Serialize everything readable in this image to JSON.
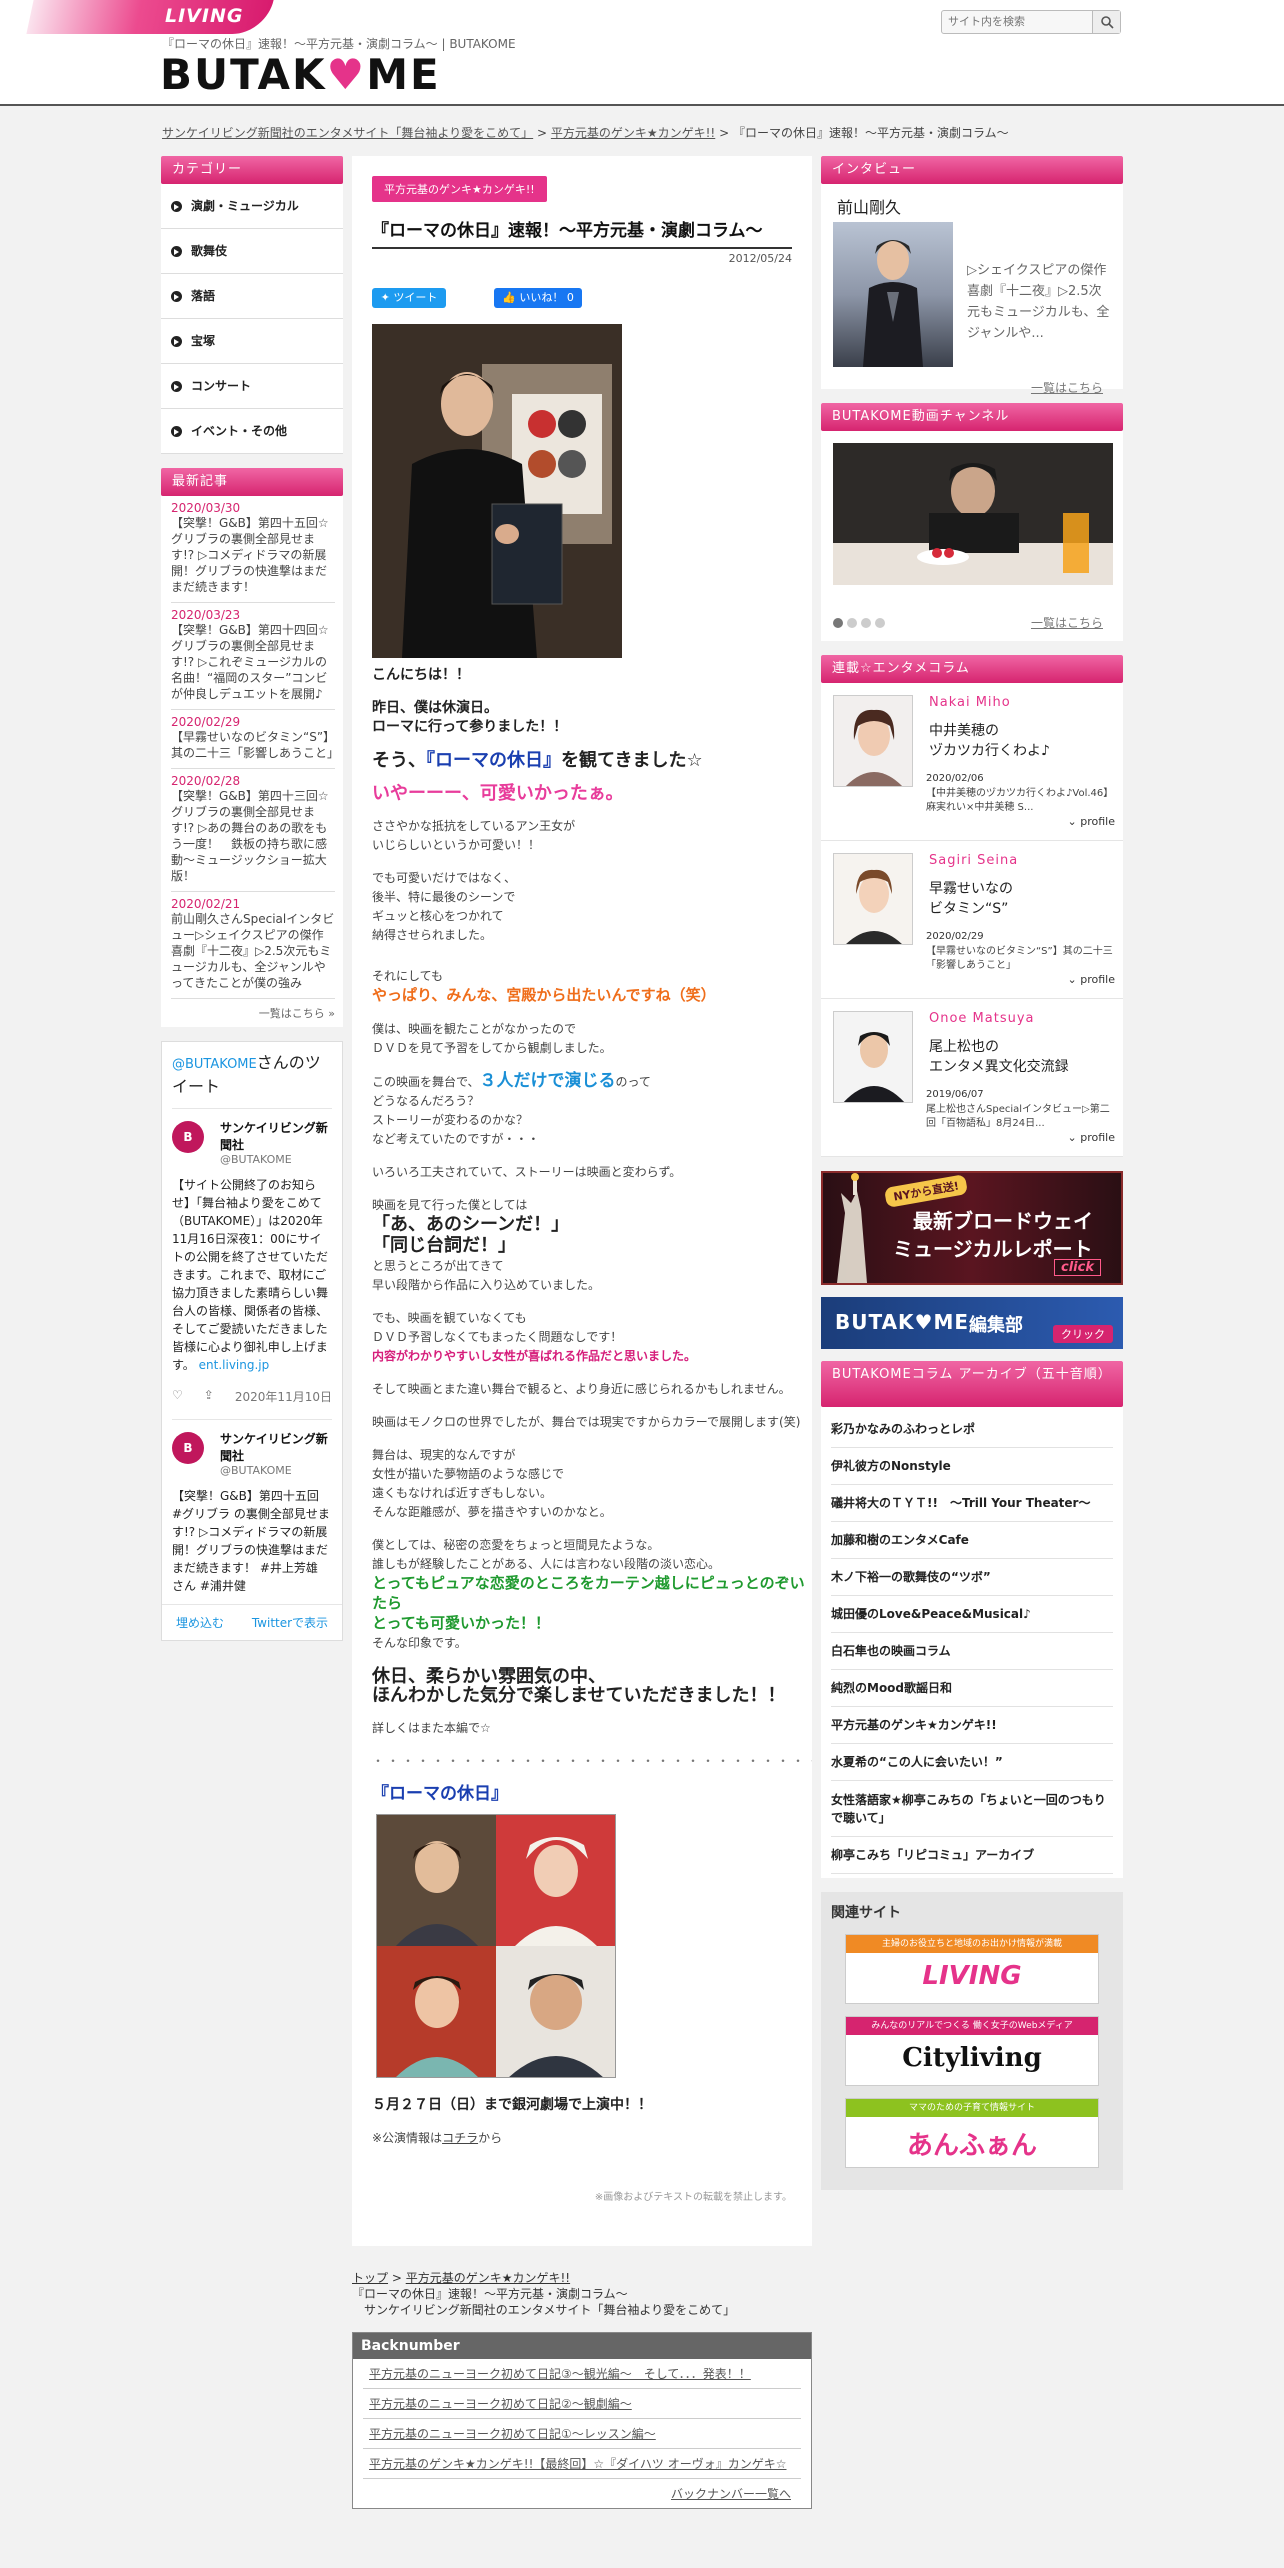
{
  "header": {
    "living_logo": "LIVING",
    "tagline": "『ローマの休日』速報！～平方元基・演劇コラム～ | BUTAKOME",
    "logo_left": "BUTAK",
    "logo_heart": "♥",
    "logo_right": "ME",
    "search_placeholder": "サイト内を検索"
  },
  "breadcrumb": {
    "home": "サンケイリビング新聞社のエンタメサイト「舞台袖より愛をこめて」",
    "sep1": " > ",
    "section": "平方元基のゲンキ★カンゲキ!!",
    "sep2": " > ",
    "current": "『ローマの休日』速報！～平方元基・演劇コラム～"
  },
  "categories": {
    "title": "カテゴリー",
    "items": [
      "演劇・ミュージカル",
      "歌舞伎",
      "落語",
      "宝塚",
      "コンサート",
      "イベント・その他"
    ]
  },
  "latest": {
    "title": "最新記事",
    "items": [
      {
        "date": "2020/03/30",
        "title": "【突撃！G&B】第四十五回☆グリブラの裏側全部見せます!? ▷コメディドラマの新展開！グリブラの快進撃はまだまだ続きます！"
      },
      {
        "date": "2020/03/23",
        "title": "【突撃！G&B】第四十四回☆グリブラの裏側全部見せます!? ▷これぞミュージカルの名曲！“福岡のスター”コンビが仲良しデュエットを展開♪"
      },
      {
        "date": "2020/02/29",
        "title": "【早霧せいなのビタミン“S”】其の二十三「影響しあうこと」"
      },
      {
        "date": "2020/02/28",
        "title": "【突撃！G&B】第四十三回☆グリブラの裏側全部見せます!? ▷あの舞台のあの歌をもう一度！　鉄板の持ち歌に感動～ミュージックショー拡大版！"
      },
      {
        "date": "2020/02/21",
        "title": "前山剛久さんSpecialインタビュー▷シェイクスピアの傑作喜劇『十二夜』▷2.5次元もミュージカルも、全ジャンルやってきたことが僕の強み"
      }
    ],
    "more": "一覧はこちら »"
  },
  "twitter": {
    "handle_link": "@BUTAKOME",
    "head_rest": "さんのツイート",
    "tweets": [
      {
        "avatar": "B",
        "name": "サンケイリビング新聞社",
        "handle": "@BUTAKOME",
        "text": "【サイト公開終了のお知らせ】「舞台袖より愛をこめて（BUTAKOME）」は2020年11月16日深夜1：00にサイトの公開を終了させていただきます。これまで、取材にご協力頂きました素晴らしい舞台人の皆様、関係者の皆様、そしてご愛読いただきました皆様に心より御礼申し上げます。",
        "link": "ent.living.jp",
        "date": "2020年11月10日"
      },
      {
        "avatar": "B",
        "name": "サンケイリビング新聞社",
        "handle": "@BUTAKOME",
        "text": "【突撃！G&B】第四十五回 #グリブラ の裏側全部見せます!? ▷コメディドラマの新展開！グリブラの快進撃はまだまだ続きます！ #井上芳雄 さん #浦井健",
        "link": "",
        "date": ""
      }
    ],
    "embed": "埋め込む",
    "view": "Twitterで表示"
  },
  "article": {
    "category_tag": "平方元基のゲンキ★カンゲキ!!",
    "title": "『ローマの休日』速報！～平方元基・演劇コラム～",
    "date": "2012/05/24",
    "tweet_btn": "ツイート",
    "like_btn": "いいね！ 0",
    "p1": "こんにちは！！",
    "p2a": "昨日、僕は休演日。",
    "p2b": "ローマに行って参りました！！",
    "p3a": "そう、",
    "p3b": "『ローマの休日』",
    "p3c": "を観てきました☆",
    "p4": "いやーーー、可愛いかったぁ。",
    "p5a": "ささやかな抵抗をしているアン王女が",
    "p5b": "いじらしいというか可愛い！！",
    "p6a": "でも可愛いだけではなく、",
    "p6b": "後半、特に最後のシーンで",
    "p6c": "ギュッと核心をつかれて",
    "p6d": "納得させられました。",
    "p7a": "それにしても",
    "p7b": "やっぱり、みんな、宮殿から出たいんですね（笑）",
    "p8a": "僕は、映画を観たことがなかったので",
    "p8b": "ＤＶＤを見て予習をしてから観劇しました。",
    "p9a": "この映画を舞台で、",
    "p9b": "３人だけで演じる",
    "p9c": "のって",
    "p9d": "どうなるんだろう？",
    "p9e": "ストーリーが変わるのかな？",
    "p9f": "など考えていたのですが・・・",
    "p10": "いろいろ工夫されていて、ストーリーは映画と変わらず。",
    "p11a": "映画を見て行った僕としては",
    "p11b": "「あ、あのシーンだ！」",
    "p11c": "「同じ台詞だ！」",
    "p11d": "と思うところが出てきて",
    "p11e": "早い段階から作品に入り込めていました。",
    "p12a": "でも、映画を観ていなくても",
    "p12b": "ＤＶＤ予習しなくてもまったく問題なしです！",
    "p12c": "内容がわかりやすいし女性が喜ばれる作品だと思いました。",
    "p13": "そして映画とまた違い舞台で観ると、より身近に感じられるかもしれません。",
    "p14": "映画はモノクロの世界でしたが、舞台では現実ですからカラーで展開します(笑)",
    "p15a": "舞台は、現実的なんですが",
    "p15b": "女性が描いた夢物語のような感じで",
    "p15c": "遠くもなければ近すぎもしない。",
    "p15d": "そんな距離感が、夢を描きやすいのかなと。",
    "p16a": "僕としては、秘密の恋愛をちょっと垣間見たような。",
    "p16b": "誰しもが経験したことがある、人には言わない段階の淡い恋心。",
    "p16c": "とってもピュアな恋愛のところをカーテン越しにピュっとのぞいたら",
    "p16d": "とっても可愛いかった！！",
    "p16e": "そんな印象です。",
    "p17a": "休日、柔らかい雰囲気の中、",
    "p17b": "ほんわかした気分で楽しませていただきました！！",
    "p18": "詳しくはまた本編で☆",
    "dots": "・・・・・・・・・・・・・・・・・・・・・・・・・・・・・・・・・・・・・・・・・・",
    "show_title": "『ローマの休日』",
    "run": "５月２７日（日）まで銀河劇場で上演中！！",
    "info_a": "※公演情報は",
    "info_link": "コチラ",
    "info_b": "から",
    "copyright": "※画像およびテキストの転載を禁止します。"
  },
  "bottom_bc": {
    "top": "トップ",
    "sep": " > ",
    "section": "平方元基のゲンキ★カンゲキ!!",
    "line2": "『ローマの休日』速報！～平方元基・演劇コラム～",
    "line3": "サンケイリビング新聞社のエンタメサイト「舞台袖より愛をこめて」"
  },
  "backnumber": {
    "title": "Backnumber",
    "items": [
      "平方元基のニューヨーク初めて日記③～観光編～　そして．．．発表！！",
      "平方元基のニューヨーク初めて日記②～観劇編～",
      "平方元基のニューヨーク初めて日記①～レッスン編～",
      "平方元基のゲンキ★カンゲキ!!【最終回】☆『ダイハツ オーヴォ』カンゲキ☆"
    ],
    "more": "バックナンバー一覧へ"
  },
  "interview": {
    "title": "インタビュー",
    "name": "前山剛久",
    "text": "▷シェイクスピアの傑作喜劇『十二夜』▷2.5次元もミュージカルも、全ジャンルや...",
    "more": "一覧はこちら"
  },
  "video": {
    "title": "BUTAKOME動画チャンネル",
    "more": "一覧はこちら"
  },
  "columns": {
    "title": "連載☆エンタメコラム",
    "items": [
      {
        "en": "Nakai Miho",
        "jp1": "中井美穂の",
        "jp2": "ヅカツカ行くわよ♪",
        "date": "2020/02/06",
        "desc": "【中井美穂のヅカツカ行くわよ♪Vol.46】麻実れい×中井美穂 S...",
        "profile": "profile"
      },
      {
        "en": "Sagiri Seina",
        "jp1": "早霧せいなの",
        "jp2": "ビタミン“S”",
        "date": "2020/02/29",
        "desc": "【早霧せいなのビタミン“S”】其の二十三「影響しあうこと」",
        "profile": "profile"
      },
      {
        "en": "Onoe Matsuya",
        "jp1": "尾上松也の",
        "jp2": "エンタメ異文化交流録",
        "date": "2019/06/07",
        "desc": "尾上松也さんSpecialインタビュー▷第二回「百物語私」8月24日...",
        "profile": "profile"
      }
    ]
  },
  "banners": {
    "broadway_tag": "NYから直送!",
    "broadway_1": "最新ブロードウェイ",
    "broadway_2": "ミュージカルレポート",
    "broadway_click": "click",
    "editorial_logo": "BUTAK♥ME",
    "editorial_label": "編集部",
    "editorial_click": "クリック"
  },
  "archive": {
    "title": "BUTAKOMEコラム アーカイブ（五十音順）",
    "items": [
      "彩乃かなみのふわっとレポ",
      "伊礼彼方のNonstyle",
      "礒井将大のＴＹＴ!!　～Trill Your Theater～",
      "加藤和樹のエンタメCafe",
      "木ノ下裕一の歌舞伎の“ツボ”",
      "城田優のLove&Peace&Musical♪",
      "白石隼也の映画コラム",
      "純烈のMood歌謡日和",
      "平方元基のゲンキ★カンゲキ!!",
      "水夏希の“この人に会いたい！”",
      "女性落語家★柳亭こみちの「ちょいと一回のつもりで聴いて」",
      "柳亭こみち「リピコミュ」アーカイブ"
    ]
  },
  "related": {
    "title": "関連サイト",
    "sites": [
      {
        "top": "主婦のお役立ちと地域のお出かけ情報が満載",
        "logo": "LIVING",
        "color": "#f08a24",
        "logo_color": "#e5338a"
      },
      {
        "top": "みんなのリアルでつくる 働く女子のWebメディア",
        "logo": "Cityliving",
        "color": "#d6246f",
        "logo_color": "#111111"
      },
      {
        "top": "ママのための子育て情報サイト",
        "logo": "あんふぁん",
        "color": "#8dc21f",
        "logo_color": "#e5338a"
      }
    ]
  }
}
